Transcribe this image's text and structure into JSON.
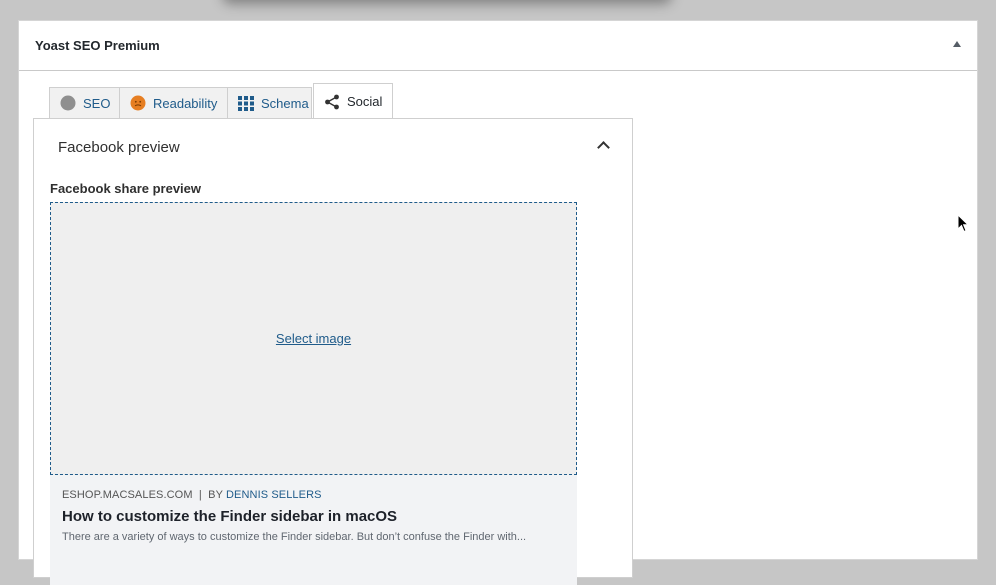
{
  "panel": {
    "title": "Yoast SEO Premium"
  },
  "tabs": [
    {
      "label": "SEO",
      "icon": "gray-dot-icon"
    },
    {
      "label": "Readability",
      "icon": "orange-face-icon"
    },
    {
      "label": "Schema",
      "icon": "grid-icon"
    },
    {
      "label": "Social",
      "icon": "share-icon",
      "active": true
    }
  ],
  "facebook": {
    "header": "Facebook preview",
    "share_label": "Facebook share preview",
    "select_image": "Select image",
    "site": "ESHOP.MACSALES.COM",
    "separator": "|",
    "by": "BY",
    "author": "DENNIS SELLERS",
    "title": "How to customize the Finder sidebar in macOS",
    "description": "There are a variety of ways to customize the Finder sidebar. But don’t confuse the Finder with..."
  },
  "colors": {
    "link": "#1f5b8a",
    "readability": "#e67e22",
    "seo_dot": "#8f8f8f"
  }
}
